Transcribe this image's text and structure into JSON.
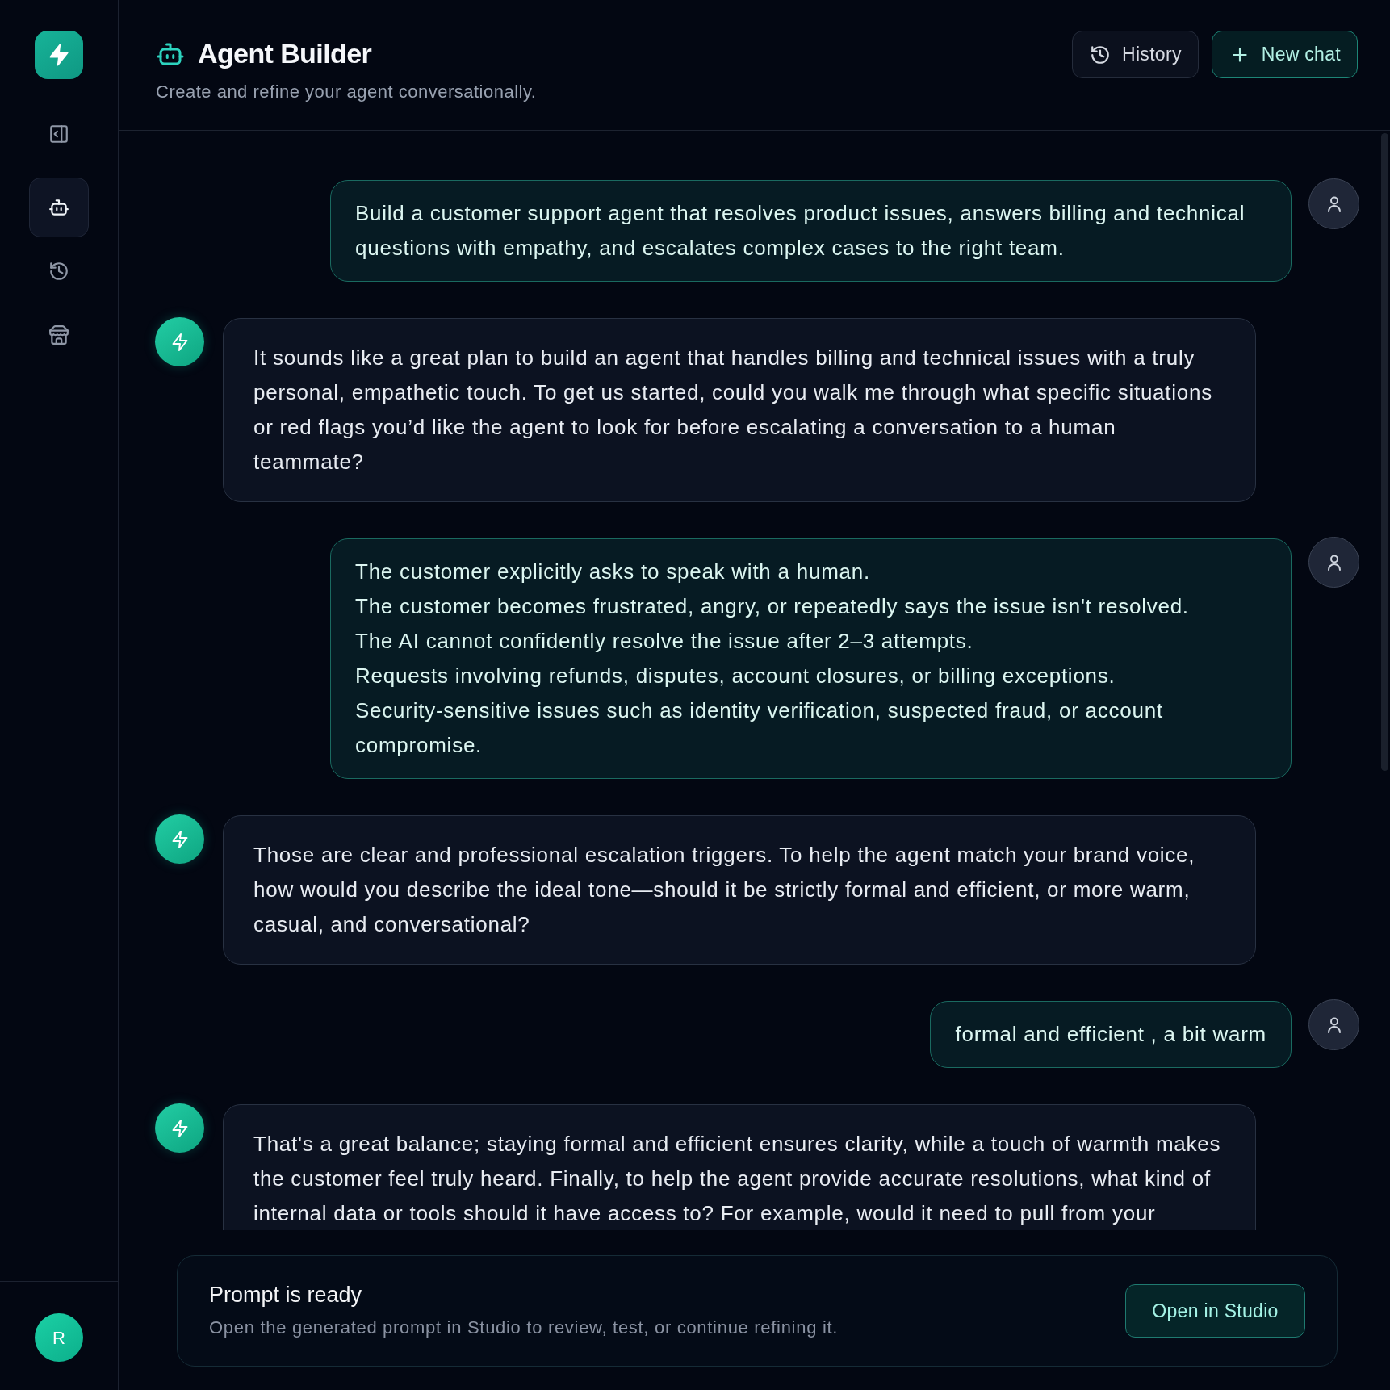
{
  "sidebar": {
    "nav_items": [
      {
        "kind": "agent",
        "selected": true
      },
      {
        "kind": "history",
        "selected": false
      },
      {
        "kind": "store",
        "selected": false
      }
    ],
    "user_initial": "R"
  },
  "header": {
    "title": "Agent Builder",
    "subtitle": "Create and refine your agent conversationally.",
    "buttons": [
      {
        "kind": "history",
        "label": "History"
      },
      {
        "kind": "new",
        "label": "New chat"
      }
    ]
  },
  "messages": [
    {
      "kind": "user",
      "paragraphs": [
        "Build a customer support agent that resolves product issues, answers billing and technical questions with empathy, and escalates complex cases to the right team."
      ]
    },
    {
      "kind": "agent",
      "paragraphs": [
        "It sounds like a great plan to build an agent that handles billing and technical issues with a truly personal, empathetic touch. To get us started, could you walk me through what specific situations or red flags you’d like the agent to look for before escalating a conversation to a human teammate?"
      ]
    },
    {
      "kind": "user",
      "paragraphs": [
        "The customer explicitly asks to speak with a human.",
        "The customer becomes frustrated, angry, or repeatedly says the issue isn't resolved.",
        "The AI cannot confidently resolve the issue after 2–3 attempts.",
        "Requests involving refunds, disputes, account closures, or billing exceptions.",
        "Security-sensitive issues such as identity verification, suspected fraud, or account compromise."
      ]
    },
    {
      "kind": "agent",
      "paragraphs": [
        "Those are clear and professional escalation triggers. To help the agent match your brand voice, how would you describe the ideal tone—should it be strictly formal and efficient, or more warm, casual, and conversational?"
      ]
    },
    {
      "kind": "user",
      "paragraphs": [
        "formal and efficient , a bit warm"
      ]
    },
    {
      "kind": "agent",
      "paragraphs": [
        "That's a great balance; staying formal and efficient ensures clarity, while a touch of warmth makes the customer feel truly heard. Finally, to help the agent provide accurate resolutions, what kind of internal data or tools should it have access to? For example, would it need to pull from your"
      ]
    }
  ],
  "prompt_ready": {
    "title": "Prompt is ready",
    "description": "Open the generated prompt in Studio to review, test, or continue refining it.",
    "button": "Open in Studio"
  }
}
